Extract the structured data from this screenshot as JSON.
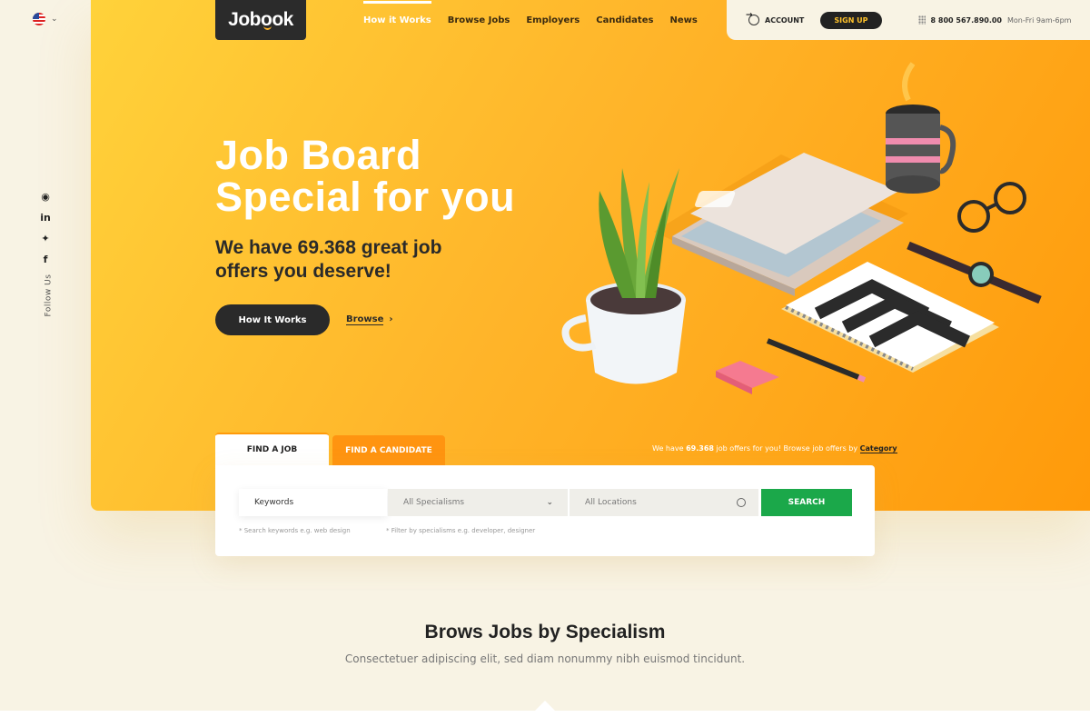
{
  "language": {
    "code": "US"
  },
  "social": {
    "items": [
      {
        "name": "rss",
        "glyph": "◉"
      },
      {
        "name": "linkedin",
        "glyph": "in"
      },
      {
        "name": "twitter",
        "glyph": "✦"
      },
      {
        "name": "facebook",
        "glyph": "f"
      }
    ],
    "follow_label": "Follow Us"
  },
  "header": {
    "logo": "Jobook",
    "nav": [
      "How it Works",
      "Browse Jobs",
      "Employers",
      "Candidates",
      "News"
    ],
    "active_nav": "How it Works",
    "account_label": "ACCOUNT",
    "signup_label": "SIGN UP",
    "phone": "8 800 567.890.00",
    "hours": "Mon-Fri 9am-6pm"
  },
  "hero": {
    "title_line1": "Job Board",
    "title_line2": "Special for you",
    "subtitle_line1": "We have 69.368 great job",
    "subtitle_line2": "offers you deserve!",
    "how_button": "How It Works",
    "browse_link": "Browse",
    "browse_arrow": "›"
  },
  "search": {
    "tabs": [
      "FIND A JOB",
      "FIND A CANDIDATE"
    ],
    "note_prefix": "We have ",
    "note_count": "69.368",
    "note_middle": " job offers for you! Browse job offers by ",
    "note_link": "Category",
    "keywords_value": "Keywords",
    "specialism_value": "All Specialisms",
    "location_value": "All Locations",
    "search_button": "SEARCH",
    "hint_keywords": "* Search keywords e.g. web design",
    "hint_specialism": "* Filter by specialisms e.g. developer, designer"
  },
  "section": {
    "title": "Brows Jobs by Specialism",
    "subtitle": "Consectetuer adipiscing elit, sed diam nonummy nibh euismod tincidunt."
  },
  "colors": {
    "accent_yellow": "#ffc22a",
    "accent_orange": "#ff9a0a",
    "search_green": "#1ba84a",
    "dark": "#2a2a2a",
    "cream": "#f8f3e4"
  }
}
